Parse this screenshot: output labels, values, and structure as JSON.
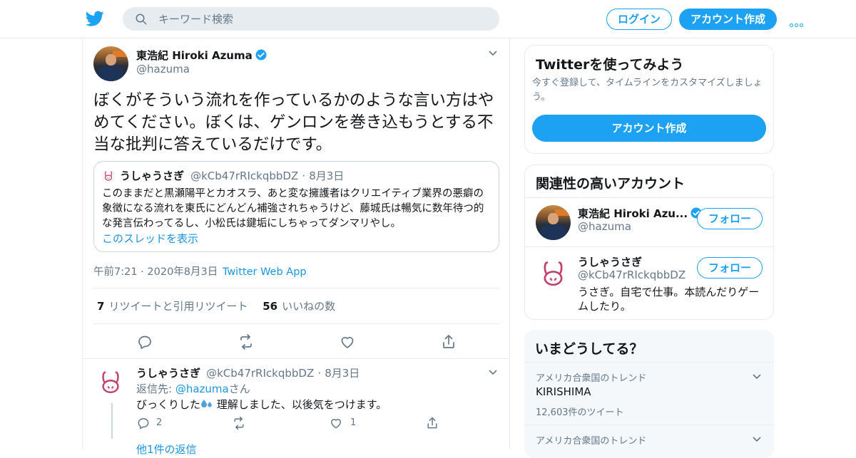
{
  "header": {
    "search_placeholder": "キーワード検索",
    "login_label": "ログイン",
    "signup_label": "アカウント作成"
  },
  "tweet": {
    "author_name": "東浩紀 Hiroki Azuma",
    "author_handle": "@hazuma",
    "text": "ぼくがそういう流れを作っているかのような言い方はやめてください。ぼくは、ゲンロンを巻き込もうとする不当な批判に答えているだけです。",
    "quote": {
      "author_name": "うしゃうさぎ",
      "author_handle": "@kCb47rRIckqbbDZ",
      "date_sep": "·",
      "date": "8月3日",
      "text": "このままだと黒瀬陽平とカオスラ、あと変な擁護者はクリエイティブ業界の悪癖の象徴になる流れを東氏にどんどん補強されちゃうけど、藤城氏は暢気に数年待つ的な発言伝わってるし、小松氏は鍵垢にしちゃってダンマリやし。",
      "show_thread": "このスレッドを表示"
    },
    "time": "午前7:21",
    "meta_sep": "·",
    "date": "2020年8月3日",
    "source": "Twitter Web App",
    "retweets_count": "7",
    "retweets_label": "リツイートと引用リツイート",
    "likes_count": "56",
    "likes_label": "いいねの数"
  },
  "reply": {
    "author_name": "うしゃうさぎ",
    "author_handle": "@kCb47rRIckqbbDZ",
    "date_sep": "·",
    "date": "8月3日",
    "reply_to_prefix": "返信先: ",
    "reply_to_handle": "@hazuma",
    "reply_to_suffix": "さん",
    "text_before_emoji": "びっくりした",
    "text_after_emoji": " 理解しました、以後気をつけます。",
    "reply_count": "2",
    "like_count": "1",
    "more_replies": "他1件の返信"
  },
  "sidebar": {
    "try_card": {
      "title": "Twitterを使ってみよう",
      "desc": "今すぐ登録して、タイムラインをカスタマイズしましょう。",
      "button": "アカウント作成"
    },
    "related": {
      "title": "関連性の高いアカウント",
      "accounts": [
        {
          "name": "東浩紀 Hiroki Azu...",
          "handle": "@hazuma",
          "follow": "フォロー",
          "bio": ""
        },
        {
          "name": "うしゃうさぎ",
          "handle": "@kCb47rRIckqbbDZ",
          "follow": "フォロー",
          "bio": "うさぎ。自宅で仕事。本読んだりゲームしたり。"
        }
      ]
    },
    "trends": {
      "title": "いまどうしてる？",
      "items": [
        {
          "context": "アメリカ合衆国のトレンド",
          "name": "KIRISHIMA",
          "count": "12,603件のツイート"
        },
        {
          "context": "アメリカ合衆国のトレンド",
          "name": "",
          "count": ""
        }
      ]
    }
  },
  "colors": {
    "accent": "#1da1f2",
    "link": "#1b95e0",
    "muted": "#657786",
    "border": "#e6ecf0"
  }
}
